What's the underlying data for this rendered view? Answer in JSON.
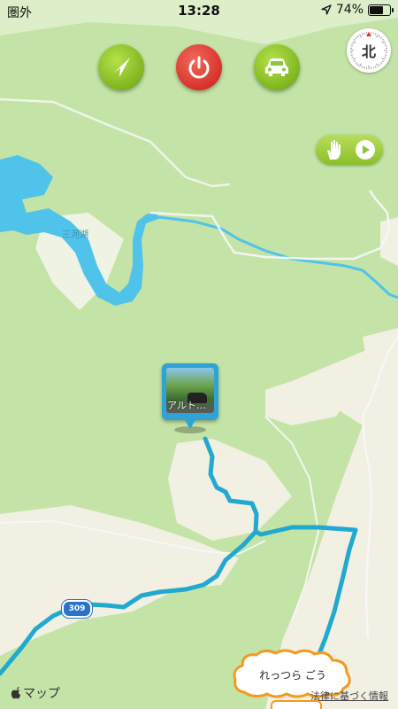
{
  "status_bar": {
    "carrier": "圏外",
    "time": "13:28",
    "battery_percent": "74%",
    "battery_level": 0.74
  },
  "toolbar": {
    "navigate_icon": "navigation-arrow-icon",
    "power_icon": "power-icon",
    "car_icon": "car-icon"
  },
  "compass": {
    "label": "北"
  },
  "map": {
    "lake_label": "三河湖",
    "route_shield": "309",
    "pin": {
      "caption": "アルト…"
    },
    "footer_left": "マップ",
    "footer_right": "法律に基づく情報"
  },
  "speech_cloud": {
    "text": "れっつら ごう"
  },
  "colors": {
    "land": "#c3e4a6",
    "settlement": "#f2efe3",
    "water": "#4fc3ea",
    "route": "#21a9cf",
    "road": "#ffffff",
    "accent_green": "#8cc63f",
    "accent_red": "#d7322a"
  }
}
